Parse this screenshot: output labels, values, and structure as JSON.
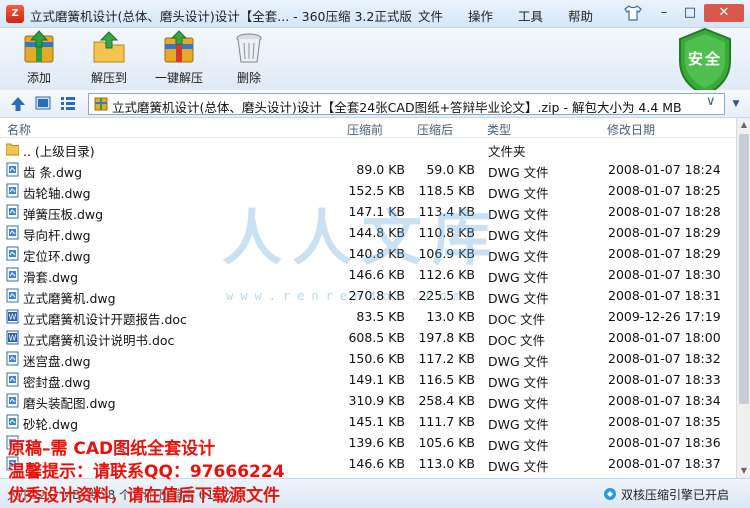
{
  "window": {
    "title": "立式磨簧机设计(总体、磨头设计)设计【全套... - 360压缩 3.2正式版",
    "menus": [
      "文件",
      "操作",
      "工具",
      "帮助"
    ],
    "app_icon_glyph": "Z"
  },
  "toolbar": {
    "add": "添加",
    "extract": "解压到",
    "oneclick": "一键解压",
    "delete": "删除",
    "security_badge": "安全"
  },
  "address": {
    "path": "立式磨簧机设计(总体、磨头设计)设计【全套24张CAD图纸+答辩毕业论文】.zip - 解包大小为 4.4 MB"
  },
  "columns": {
    "name": "名称",
    "size": "压缩前",
    "packed": "压缩后",
    "type": "类型",
    "date": "修改日期"
  },
  "files": [
    {
      "name": ".. (上级目录)",
      "size": "",
      "packed": "",
      "type": "文件夹",
      "date": "",
      "kind": "folder"
    },
    {
      "name": "齿 条.dwg",
      "size": "89.0 KB",
      "packed": "59.0 KB",
      "type": "DWG 文件",
      "date": "2008-01-07 18:24",
      "kind": "dwg"
    },
    {
      "name": "齿轮轴.dwg",
      "size": "152.5 KB",
      "packed": "118.5 KB",
      "type": "DWG 文件",
      "date": "2008-01-07 18:25",
      "kind": "dwg"
    },
    {
      "name": "弹簧压板.dwg",
      "size": "147.1 KB",
      "packed": "113.4 KB",
      "type": "DWG 文件",
      "date": "2008-01-07 18:28",
      "kind": "dwg"
    },
    {
      "name": "导向杆.dwg",
      "size": "144.8 KB",
      "packed": "110.8 KB",
      "type": "DWG 文件",
      "date": "2008-01-07 18:29",
      "kind": "dwg"
    },
    {
      "name": "定位环.dwg",
      "size": "140.8 KB",
      "packed": "106.9 KB",
      "type": "DWG 文件",
      "date": "2008-01-07 18:29",
      "kind": "dwg"
    },
    {
      "name": "滑套.dwg",
      "size": "146.6 KB",
      "packed": "112.6 KB",
      "type": "DWG 文件",
      "date": "2008-01-07 18:30",
      "kind": "dwg"
    },
    {
      "name": "立式磨簧机.dwg",
      "size": "270.8 KB",
      "packed": "225.5 KB",
      "type": "DWG 文件",
      "date": "2008-01-07 18:31",
      "kind": "dwg"
    },
    {
      "name": "立式磨簧机设计开题报告.doc",
      "size": "83.5 KB",
      "packed": "13.0 KB",
      "type": "DOC 文件",
      "date": "2009-12-26 17:19",
      "kind": "doc"
    },
    {
      "name": "立式磨簧机设计说明书.doc",
      "size": "608.5 KB",
      "packed": "197.8 KB",
      "type": "DOC 文件",
      "date": "2008-01-07 18:00",
      "kind": "doc"
    },
    {
      "name": "迷宫盘.dwg",
      "size": "150.6 KB",
      "packed": "117.2 KB",
      "type": "DWG 文件",
      "date": "2008-01-07 18:32",
      "kind": "dwg"
    },
    {
      "name": "密封盘.dwg",
      "size": "149.1 KB",
      "packed": "116.5 KB",
      "type": "DWG 文件",
      "date": "2008-01-07 18:33",
      "kind": "dwg"
    },
    {
      "name": "磨头装配图.dwg",
      "size": "310.9 KB",
      "packed": "258.4 KB",
      "type": "DWG 文件",
      "date": "2008-01-07 18:34",
      "kind": "dwg"
    },
    {
      "name": "砂轮.dwg",
      "size": "145.1 KB",
      "packed": "111.7 KB",
      "type": "DWG 文件",
      "date": "2008-01-07 18:35",
      "kind": "dwg"
    },
    {
      "name": "",
      "size": "139.6 KB",
      "packed": "105.6 KB",
      "type": "DWG 文件",
      "date": "2008-01-07 18:36",
      "kind": "dwg"
    },
    {
      "name": "",
      "size": "146.6 KB",
      "packed": "113.0 KB",
      "type": "DWG 文件",
      "date": "2008-01-07 18:37",
      "kind": "dwg"
    }
  ],
  "watermark": {
    "big": "人人文库",
    "small": "www.renrendoc.com"
  },
  "status": {
    "left": "大小: 2.7 MB 共 28 个文件 压缩率 61.0%",
    "right": "双核压缩引擎已开启"
  },
  "overlay": {
    "line1": "原稿–需 CAD图纸全套设计",
    "line2": "温馨提示：请联系QQ：97666224",
    "line3": "优秀设计资料，请在值后下载源文件"
  },
  "colors": {
    "accent": "#2b6cb8",
    "security_green": "#3aa83a",
    "overlay_red": "#e8120c",
    "watermark_blue": "#68a8d8"
  },
  "icons": {
    "folder": "folder-icon",
    "dwg": "dwg-file-icon",
    "doc": "doc-file-icon"
  }
}
